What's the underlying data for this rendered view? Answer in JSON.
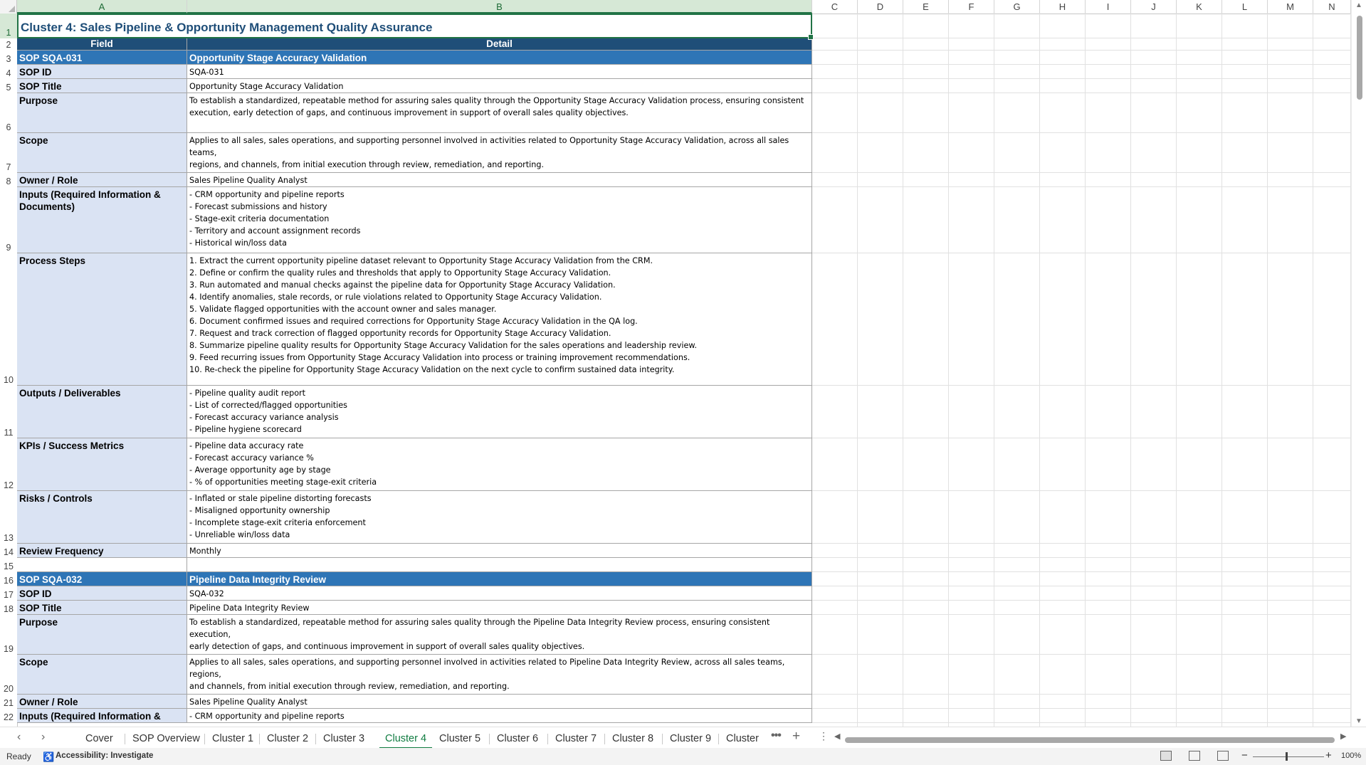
{
  "columns": [
    "A",
    "B",
    "C",
    "D",
    "E",
    "F",
    "G",
    "H",
    "I",
    "J",
    "K",
    "L",
    "M",
    "N"
  ],
  "title": "Cluster 4: Sales Pipeline & Opportunity Management Quality Assurance",
  "header": {
    "field": "Field",
    "detail": "Detail"
  },
  "rows": [
    {
      "n": "3",
      "a": "SOP SQA-031",
      "b": "Opportunity Stage Accuracy Validation",
      "kind": "band"
    },
    {
      "n": "4",
      "a": "SOP ID",
      "b": "SQA-031"
    },
    {
      "n": "5",
      "a": "SOP Title",
      "b": "Opportunity Stage Accuracy Validation"
    },
    {
      "n": "6",
      "a": "Purpose",
      "b": "To establish a standardized, repeatable method for assuring sales quality through the Opportunity Stage Accuracy Validation process, ensuring consistent\nexecution, early detection of gaps, and continuous improvement in support of overall sales quality objectives."
    },
    {
      "n": "7",
      "a": "Scope",
      "b": "Applies to all sales, sales operations, and supporting personnel involved in activities related to Opportunity Stage Accuracy Validation, across all sales teams,\nregions, and channels, from initial execution through review, remediation, and reporting."
    },
    {
      "n": "8",
      "a": "Owner / Role",
      "b": "Sales Pipeline Quality Analyst"
    },
    {
      "n": "9",
      "a": "Inputs (Required Information & Documents)",
      "b": "- CRM opportunity and pipeline reports\n- Forecast submissions and history\n- Stage-exit criteria documentation\n- Territory and account assignment records\n- Historical win/loss data"
    },
    {
      "n": "10",
      "a": "Process Steps",
      "b": "1. Extract the current opportunity pipeline dataset relevant to Opportunity Stage Accuracy Validation from the CRM.\n2. Define or confirm the quality rules and thresholds that apply to Opportunity Stage Accuracy Validation.\n3. Run automated and manual checks against the pipeline data for Opportunity Stage Accuracy Validation.\n4. Identify anomalies, stale records, or rule violations related to Opportunity Stage Accuracy Validation.\n5. Validate flagged opportunities with the account owner and sales manager.\n6. Document confirmed issues and required corrections for Opportunity Stage Accuracy Validation in the QA log.\n7. Request and track correction of flagged opportunity records for Opportunity Stage Accuracy Validation.\n8. Summarize pipeline quality results for Opportunity Stage Accuracy Validation for the sales operations and leadership review.\n9. Feed recurring issues from Opportunity Stage Accuracy Validation into process or training improvement recommendations.\n10. Re-check the pipeline for Opportunity Stage Accuracy Validation on the next cycle to confirm sustained data integrity."
    },
    {
      "n": "11",
      "a": "Outputs / Deliverables",
      "b": "- Pipeline quality audit report\n- List of corrected/flagged opportunities\n- Forecast accuracy variance analysis\n- Pipeline hygiene scorecard"
    },
    {
      "n": "12",
      "a": "KPIs / Success Metrics",
      "b": "- Pipeline data accuracy rate\n- Forecast accuracy variance %\n- Average opportunity age by stage\n- % of opportunities meeting stage-exit criteria"
    },
    {
      "n": "13",
      "a": "Risks / Controls",
      "b": "- Inflated or stale pipeline distorting forecasts\n- Misaligned opportunity ownership\n- Incomplete stage-exit criteria enforcement\n- Unreliable win/loss data"
    },
    {
      "n": "14",
      "a": "Review Frequency",
      "b": "Monthly"
    },
    {
      "n": "15",
      "a": "",
      "b": "",
      "kind": "blank"
    },
    {
      "n": "16",
      "a": "SOP SQA-032",
      "b": "Pipeline Data Integrity Review",
      "kind": "band"
    },
    {
      "n": "17",
      "a": "SOP ID",
      "b": "SQA-032"
    },
    {
      "n": "18",
      "a": "SOP Title",
      "b": "Pipeline Data Integrity Review"
    },
    {
      "n": "19",
      "a": "Purpose",
      "b": "To establish a standardized, repeatable method for assuring sales quality through the Pipeline Data Integrity Review process, ensuring consistent execution,\nearly detection of gaps, and continuous improvement in support of overall sales quality objectives."
    },
    {
      "n": "20",
      "a": "Scope",
      "b": "Applies to all sales, sales operations, and supporting personnel involved in activities related to Pipeline Data Integrity Review, across all sales teams, regions,\nand channels, from initial execution through review, remediation, and reporting."
    },
    {
      "n": "21",
      "a": "Owner / Role",
      "b": "Sales Pipeline Quality Analyst"
    },
    {
      "n": "22",
      "a": "Inputs (Required Information &",
      "b": "- CRM opportunity and pipeline reports"
    }
  ],
  "tabs": [
    "Cover",
    "SOP Overview",
    "Cluster 1",
    "Cluster 2",
    "Cluster 3",
    "Cluster 4",
    "Cluster 5",
    "Cluster 6",
    "Cluster 7",
    "Cluster 8",
    "Cluster 9",
    "Cluster "
  ],
  "active_tab": "Cluster 4",
  "status": {
    "ready": "Ready",
    "accessibility": "Accessibility: Investigate",
    "zoom": "100%"
  },
  "colors": {
    "band": "#2e75b6",
    "header": "#1f4e78",
    "field_bg": "#dae3f3",
    "accent": "#217346"
  }
}
